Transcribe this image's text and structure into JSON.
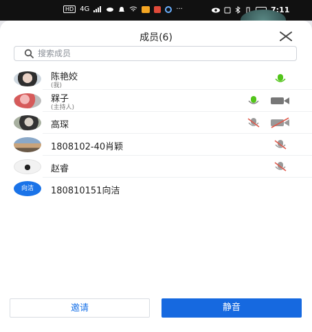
{
  "status_bar": {
    "left_chip": "HD",
    "signal_text": "4G",
    "time": "7:11"
  },
  "panel": {
    "title": "成员(6)",
    "search_placeholder": "搜索成员"
  },
  "members": [
    {
      "name": "陈艳姣",
      "role": "(我)",
      "mic": "active",
      "camera": "none"
    },
    {
      "name": "槑子",
      "role": "(主持人)",
      "mic": "active",
      "camera": "on"
    },
    {
      "name": "高琛",
      "role": "",
      "mic": "muted",
      "camera": "off"
    },
    {
      "name": "1808102-40肖颖",
      "role": "",
      "mic": "muted",
      "camera": "none"
    },
    {
      "name": "赵睿",
      "role": "",
      "mic": "muted",
      "camera": "none"
    },
    {
      "name": "180810151向洁",
      "role": "",
      "mic": "none",
      "camera": "none",
      "avatar_text": "向洁"
    }
  ],
  "actions": {
    "invite": "邀请",
    "mute": "静音"
  },
  "colors": {
    "accent": "#1669e0",
    "mic_active": "#52c41a",
    "mic_muted": "#e0584a"
  }
}
